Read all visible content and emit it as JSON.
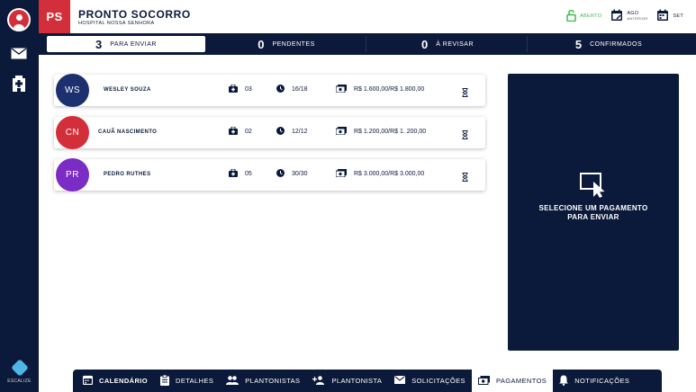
{
  "header": {
    "badge": "PS",
    "title": "PRONTO SOCORRO",
    "subtitle": "HOSPITAL NOSSA SENHORA",
    "status_label": "ABERTO",
    "month_prev": "AGO",
    "month_prev_sub": "ANTERIOR",
    "month_current": "SET"
  },
  "stats": [
    {
      "count": "3",
      "label": "PARA ENVIAR"
    },
    {
      "count": "0",
      "label": "PENDENTES"
    },
    {
      "count": "0",
      "label": "À REVISAR"
    },
    {
      "count": "5",
      "label": "CONFIRMADOS"
    }
  ],
  "payments": [
    {
      "initials": "WS",
      "name": "WESLEY SOUZA",
      "shifts": "03",
      "hours": "16/18",
      "amount": "R$ 1.600,00/R$ 1.800,00",
      "color": "#1c2f6e"
    },
    {
      "initials": "CN",
      "name": "CAUÃ NASCIMENTO",
      "shifts": "02",
      "hours": "12/12",
      "amount": "R$ 1.200,00/R$ 1. 200,00",
      "color": "#d32f3a"
    },
    {
      "initials": "PR",
      "name": "PEDRO RUTHES",
      "shifts": "05",
      "hours": "30/30",
      "amount": "R$ 3.000,00/R$ 3.000,00",
      "color": "#7b2cc4"
    }
  ],
  "panel": {
    "line1": "SELECIONE UM PAGAMENTO",
    "line2": "PARA ENVIAR"
  },
  "nav": {
    "calendario": "CALENDÁRIO",
    "detalhes": "DETALHES",
    "plantonistas": "PLANTONISTAS",
    "plantonista": "PLANTONISTA",
    "solicitacoes": "SOLICITAÇÕES",
    "pagamentos": "PAGAMENTOS",
    "notificacoes": "NOTIFICAÇÕES"
  },
  "logo_text": "ESCALIZE",
  "colors": {
    "navy": "#0b1a3a",
    "red": "#d32f3a",
    "green": "#3dbb4a"
  }
}
